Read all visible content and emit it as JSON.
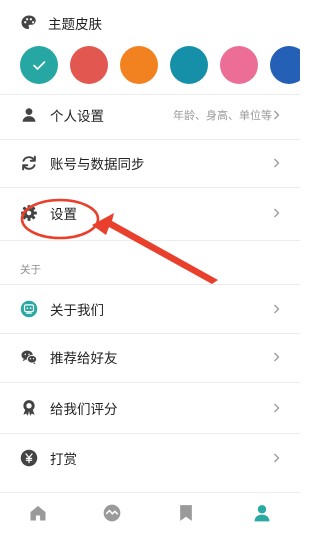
{
  "theme": {
    "title": "主题皮肤",
    "icon": "palette-icon",
    "swatches": [
      {
        "name": "teal",
        "color": "#27a7a3",
        "selected": true
      },
      {
        "name": "red",
        "color": "#e2574f",
        "selected": false
      },
      {
        "name": "orange",
        "color": "#f2821f",
        "selected": false
      },
      {
        "name": "blue-green",
        "color": "#1690a8",
        "selected": false
      },
      {
        "name": "pink",
        "color": "#ec6d95",
        "selected": false
      },
      {
        "name": "blue",
        "color": "#2460b5",
        "selected": false
      }
    ]
  },
  "menu": {
    "personal": {
      "label": "个人设置",
      "hint": "年龄、身高、单位等",
      "icon": "person-icon"
    },
    "sync": {
      "label": "账号与数据同步",
      "icon": "sync-icon"
    },
    "settings": {
      "label": "设置",
      "icon": "gear-icon"
    }
  },
  "about": {
    "section_label": "关于",
    "items": [
      {
        "label": "关于我们",
        "icon": "about-badge-icon"
      },
      {
        "label": "推荐给好友",
        "icon": "wechat-icon"
      },
      {
        "label": "给我们评分",
        "icon": "rating-icon"
      },
      {
        "label": "打赏",
        "icon": "yen-icon"
      }
    ]
  },
  "tabbar": {
    "tabs": [
      {
        "name": "home",
        "icon": "home-icon",
        "active": false
      },
      {
        "name": "stats",
        "icon": "trend-icon",
        "active": false
      },
      {
        "name": "bookmark",
        "icon": "bookmark-icon",
        "active": false
      },
      {
        "name": "profile",
        "icon": "profile-icon",
        "active": true
      }
    ]
  },
  "colors": {
    "accent": "#2aa9a2",
    "annotation": "#e8402c",
    "icon": "#444444",
    "inactive_tab": "#9a9a9a"
  }
}
